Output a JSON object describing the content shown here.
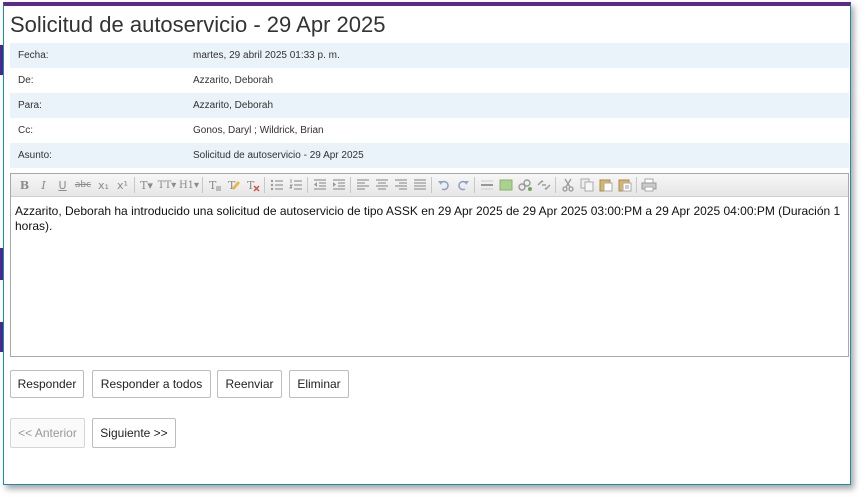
{
  "title": "Solicitud de autoservicio - 29 Apr 2025",
  "header": [
    {
      "label": "Fecha:",
      "value": "martes, 29 abril 2025 01:33 p. m."
    },
    {
      "label": "De:",
      "value": "Azzarito, Deborah"
    },
    {
      "label": "Para:",
      "value": "Azzarito, Deborah"
    },
    {
      "label": "Cc:",
      "value": "Gonos, Daryl ; Wildrick, Brian"
    },
    {
      "label": "Asunto:",
      "value": "Solicitud de autoservicio - 29 Apr 2025"
    }
  ],
  "toolbar": {
    "bold": "B",
    "italic": "I",
    "underline": "U",
    "strike": "abc",
    "subscript": "x₁",
    "superscript": "x¹",
    "font": "T▾",
    "size": "TT▾",
    "heading": "H1▾"
  },
  "body_text": "Azzarito, Deborah ha introducido una solicitud de autoservicio de tipo ASSK en 29 Apr 2025 de 29 Apr 2025 03:00:PM a 29 Apr 2025 04:00:PM (Duración 1 horas).",
  "actions": {
    "reply": "Responder",
    "reply_all": "Responder a todos",
    "forward": "Reenviar",
    "delete": "Eliminar"
  },
  "nav": {
    "prev": "<< Anterior",
    "next": "Siguiente >>"
  }
}
